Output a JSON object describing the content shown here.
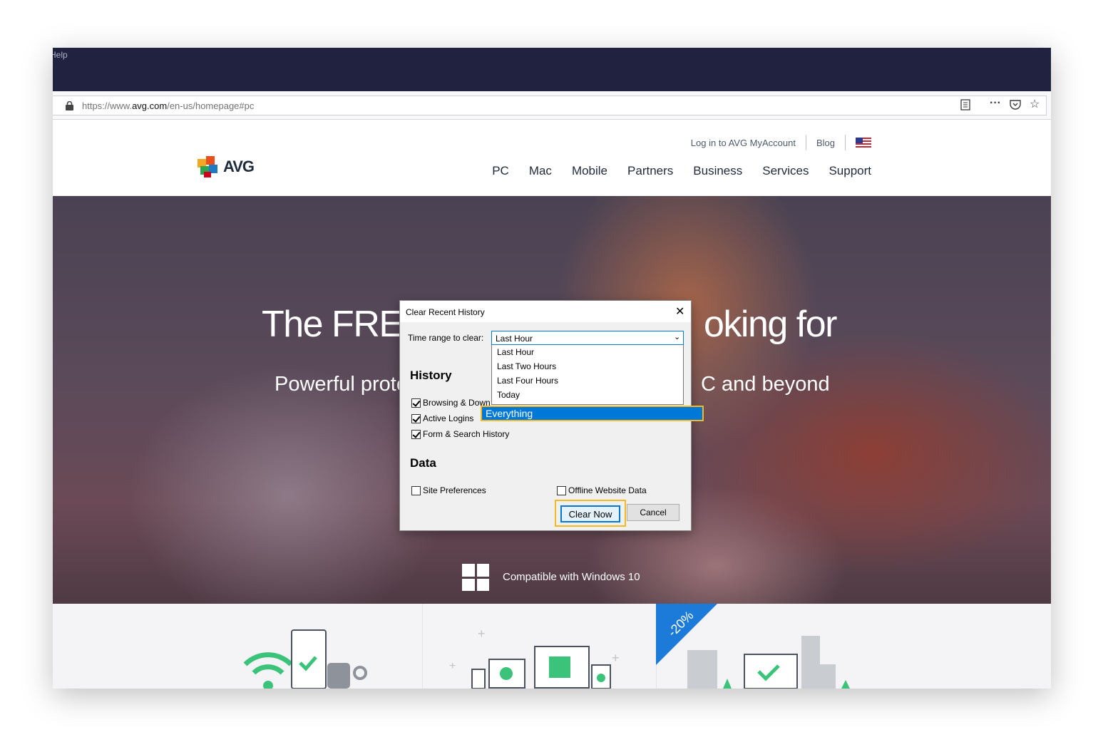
{
  "browser": {
    "menu_help": "Help",
    "url_domain_prefix": "https://www.",
    "url_domain": "avg.com",
    "url_path": "/en-us/homepage#pc",
    "icons": [
      "lock-icon",
      "reader-view-icon",
      "more-icon",
      "pocket-icon",
      "bookmark-star-icon"
    ]
  },
  "site": {
    "logo_text": "AVG",
    "toplinks": {
      "login": "Log in to AVG MyAccount",
      "blog": "Blog"
    },
    "nav": [
      "PC",
      "Mac",
      "Mobile",
      "Partners",
      "Business",
      "Services",
      "Support"
    ],
    "hero": {
      "headline_left": "The FREE",
      "headline_right": "oking for",
      "sub_left": "Powerful prote",
      "sub_right": "C and beyond",
      "compat": "Compatible with Windows 10"
    },
    "promo": "-20%"
  },
  "dialog": {
    "title": "Clear Recent History",
    "time_range_label": "Time range to clear:",
    "selected": "Last Hour",
    "options": [
      "Last Hour",
      "Last Two Hours",
      "Last Four Hours",
      "Today",
      "Everything"
    ],
    "highlighted_option": "Everything",
    "history_heading": "History",
    "history_items": [
      {
        "label": "Browsing & Down",
        "checked": true
      },
      {
        "label": "Active Logins",
        "checked": true
      },
      {
        "label": "Form & Search History",
        "checked": true
      }
    ],
    "data_heading": "Data",
    "data_items": [
      {
        "label": "Site Preferences",
        "checked": false
      },
      {
        "label": "Offline Website Data",
        "checked": false
      }
    ],
    "clear_button": "Clear Now",
    "cancel_button": "Cancel"
  },
  "colors": {
    "accent": "#0078d7",
    "highlight": "#f5b921",
    "menubar": "#20223f",
    "promo": "#1c7bd8"
  }
}
